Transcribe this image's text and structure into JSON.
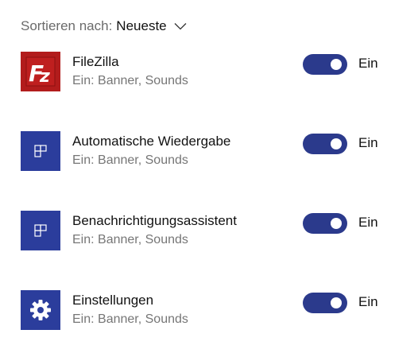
{
  "sort": {
    "label": "Sortieren nach:",
    "value": "Neueste"
  },
  "apps": [
    {
      "name": "FileZilla",
      "subtitle": "Ein: Banner, Sounds",
      "toggle_on": true,
      "state_label": "Ein",
      "icon": "filezilla-icon",
      "icon_color": "#b21c1c"
    },
    {
      "name": "Automatische Wiedergabe",
      "subtitle": "Ein: Banner, Sounds",
      "toggle_on": true,
      "state_label": "Ein",
      "icon": "app-placeholder-icon",
      "icon_color": "#2b3d9c"
    },
    {
      "name": "Benachrichtigungsassistent",
      "subtitle": "Ein: Banner, Sounds",
      "toggle_on": true,
      "state_label": "Ein",
      "icon": "app-placeholder-icon",
      "icon_color": "#2b3d9c"
    },
    {
      "name": "Einstellungen",
      "subtitle": "Ein: Banner, Sounds",
      "toggle_on": true,
      "state_label": "Ein",
      "icon": "gear-icon",
      "icon_color": "#2b3d9c"
    }
  ],
  "colors": {
    "toggle_on": "#2b3a8c",
    "accent": "#2b3d9c"
  }
}
